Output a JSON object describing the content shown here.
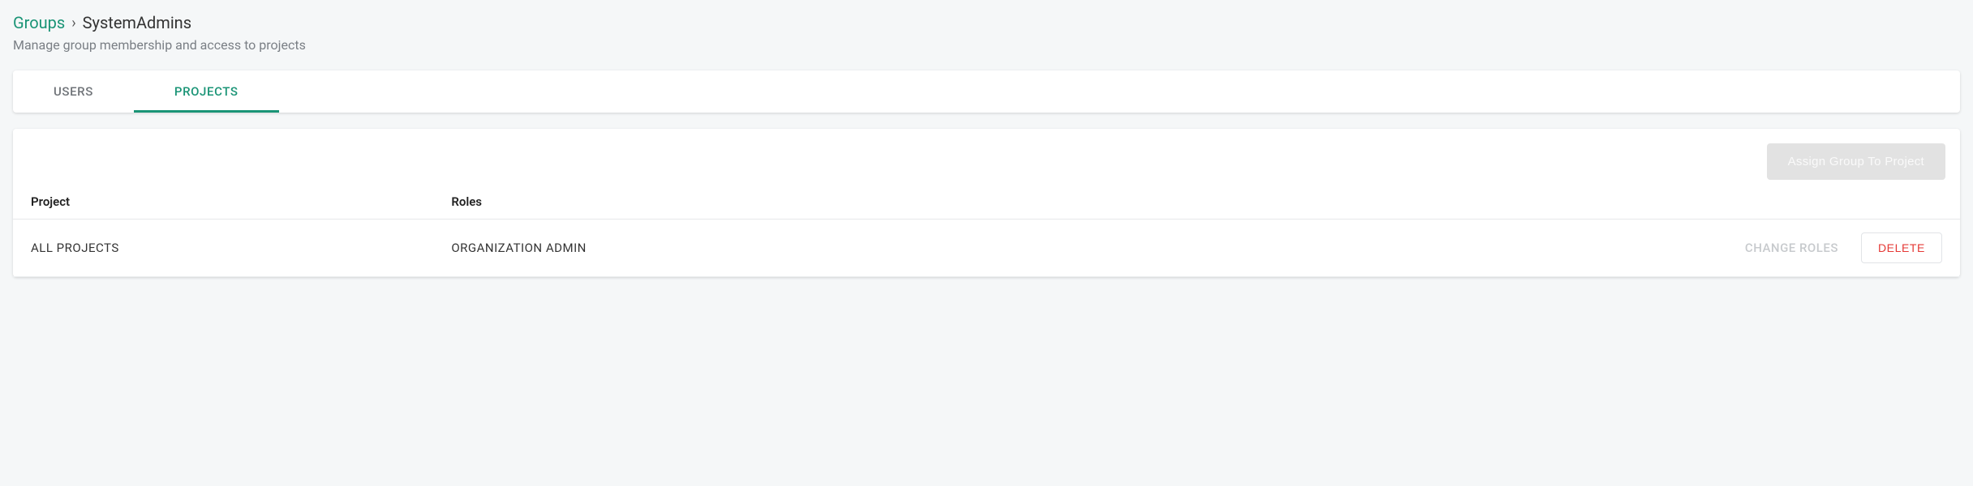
{
  "breadcrumb": {
    "root_label": "Groups",
    "separator": "›",
    "current": "SystemAdmins"
  },
  "page_subtitle": "Manage group membership and access to projects",
  "tabs": {
    "users": "USERS",
    "projects": "PROJECTS"
  },
  "toolbar": {
    "assign_button_label": "Assign Group To Project"
  },
  "table": {
    "headers": {
      "project": "Project",
      "roles": "Roles"
    },
    "rows": [
      {
        "project": "ALL PROJECTS",
        "roles": "ORGANIZATION ADMIN",
        "change_roles_label": "CHANGE ROLES",
        "delete_label": "DELETE"
      }
    ]
  }
}
